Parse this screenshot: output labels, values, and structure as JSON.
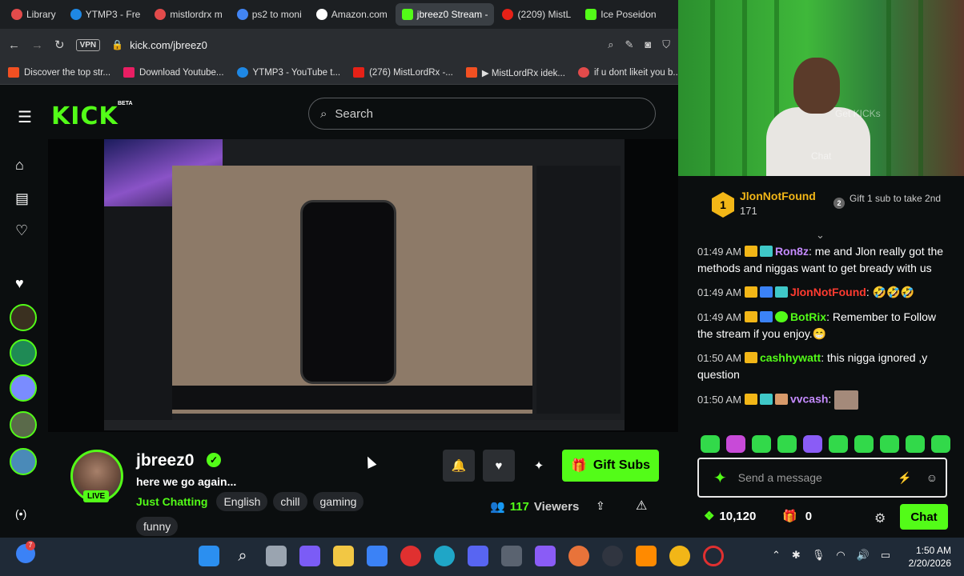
{
  "browser": {
    "tabs": [
      {
        "label": "Library",
        "color": "#e24b4b"
      },
      {
        "label": "YTMP3 - Fre",
        "color": "#1e88e5"
      },
      {
        "label": "mistlordrx m",
        "color": "#e24b4b"
      },
      {
        "label": "ps2 to moni",
        "color": "#4285f4"
      },
      {
        "label": "Amazon.com",
        "color": "#ffffff"
      },
      {
        "label": "jbreez0 Stream - ",
        "color": "#53fc18"
      },
      {
        "label": "(2209) MistL",
        "color": "#e62117"
      },
      {
        "label": "Ice Poseidon",
        "color": "#53fc18"
      }
    ],
    "url": "kick.com/jbreez0",
    "vpn_label": "VPN",
    "bookmarks": [
      {
        "label": "Discover the top str...",
        "color": "#f25022"
      },
      {
        "label": "Download Youtube...",
        "color": "#e91e63"
      },
      {
        "label": "YTMP3 - YouTube t...",
        "color": "#1e88e5"
      },
      {
        "label": "(276) MistLordRx -...",
        "color": "#e62117"
      },
      {
        "label": "▶ MistLordRx idek...",
        "color": "#f25022"
      },
      {
        "label": "if u dont likeit you b...",
        "color": "#e24b4b"
      }
    ]
  },
  "kick": {
    "logo": "KICK",
    "logo_badge": "BETA",
    "search_placeholder": "Search"
  },
  "stream": {
    "streamer_name": "jbreez0",
    "live_label": "LIVE",
    "title": "here we go again...",
    "category": "Just Chatting",
    "tags": [
      "English",
      "chill",
      "gaming",
      "funny"
    ],
    "gift_button": "Gift Subs",
    "viewers_count": "117",
    "viewers_label": "Viewers"
  },
  "webcam": {
    "overlay_texts": [
      "Get KICKs",
      "Chat"
    ]
  },
  "chat": {
    "top_gifter": {
      "rank": "1",
      "name": "JlonNotFound",
      "count": "171"
    },
    "gift_rank": "2",
    "gift_prompt": "Gift 1 sub to take 2nd",
    "messages": [
      {
        "time": "01:49 AM",
        "user": "Ron8z",
        "user_color": "#c58bff",
        "text": "me and Jlon really got the methods and niggas want to get bready with us"
      },
      {
        "time": "01:49 AM",
        "user": "JlonNotFound",
        "user_color": "#ff3b30",
        "text": "🤣🤣🤣"
      },
      {
        "time": "01:49 AM",
        "user": "BotRix",
        "user_color": "#53fc18",
        "text": "Remember to Follow the stream if you enjoy.😁"
      },
      {
        "time": "01:50 AM",
        "user": "cashhywatt",
        "user_color": "#53fc18",
        "text": "this nigga ignored ,y question"
      },
      {
        "time": "01:50 AM",
        "user": "vvcash",
        "user_color": "#c58bff",
        "text": ""
      }
    ],
    "input_placeholder": "Send a message",
    "points": "10,120",
    "gift_count": "0",
    "chat_button": "Chat"
  },
  "taskbar": {
    "time": "1:50 AM",
    "date": "2/20/2026",
    "weather_badge": "7"
  }
}
